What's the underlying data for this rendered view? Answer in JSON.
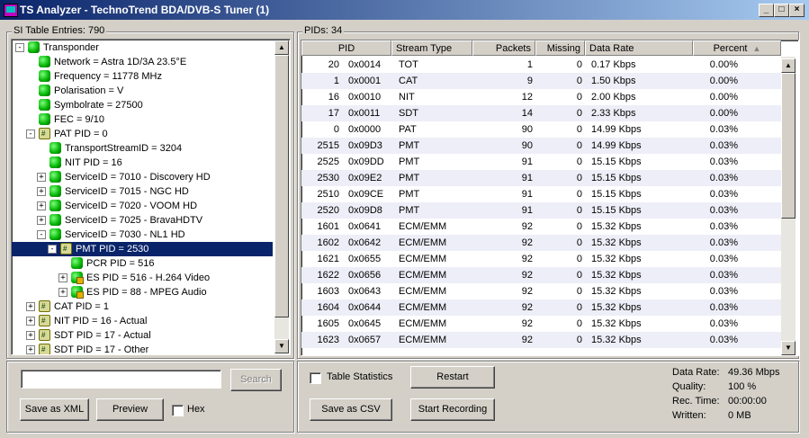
{
  "window": {
    "title": "TS Analyzer - TechnoTrend BDA/DVB-S Tuner (1)",
    "controls": [
      "_",
      "□",
      "×"
    ]
  },
  "left_panel": {
    "label": "SI Table Entries: 790",
    "tree": [
      {
        "depth": 0,
        "label": "Transponder",
        "icon": "node",
        "exp": "-"
      },
      {
        "depth": 1,
        "label": "Network = Astra 1D/3A 23.5°E",
        "icon": "node",
        "exp": ""
      },
      {
        "depth": 1,
        "label": "Frequency = 11778 MHz",
        "icon": "node",
        "exp": ""
      },
      {
        "depth": 1,
        "label": "Polarisation = V",
        "icon": "node",
        "exp": ""
      },
      {
        "depth": 1,
        "label": "Symbolrate = 27500",
        "icon": "node",
        "exp": ""
      },
      {
        "depth": 1,
        "label": "FEC = 9/10",
        "icon": "node",
        "exp": ""
      },
      {
        "depth": 1,
        "label": "PAT PID = 0",
        "icon": "folder",
        "exp": "-"
      },
      {
        "depth": 2,
        "label": "TransportStreamID = 3204",
        "icon": "node",
        "exp": ""
      },
      {
        "depth": 2,
        "label": "NIT PID = 16",
        "icon": "node",
        "exp": ""
      },
      {
        "depth": 2,
        "label": "ServiceID = 7010 - Discovery HD",
        "icon": "node",
        "exp": "+"
      },
      {
        "depth": 2,
        "label": "ServiceID = 7015 - NGC HD",
        "icon": "node",
        "exp": "+"
      },
      {
        "depth": 2,
        "label": "ServiceID = 7020 - VOOM HD",
        "icon": "node",
        "exp": "+"
      },
      {
        "depth": 2,
        "label": "ServiceID = 7025 - BravaHDTV",
        "icon": "node",
        "exp": "+"
      },
      {
        "depth": 2,
        "label": "ServiceID = 7030 - NL1 HD",
        "icon": "node",
        "exp": "-"
      },
      {
        "depth": 3,
        "label": "PMT PID = 2530",
        "icon": "folder",
        "exp": "-",
        "selected": true
      },
      {
        "depth": 4,
        "label": "PCR PID = 516",
        "icon": "node",
        "exp": ""
      },
      {
        "depth": 4,
        "label": "ES PID = 516 - H.264 Video",
        "icon": "es",
        "exp": "+"
      },
      {
        "depth": 4,
        "label": "ES PID = 88 - MPEG Audio",
        "icon": "es",
        "exp": "+"
      },
      {
        "depth": 1,
        "label": "CAT PID = 1",
        "icon": "folder",
        "exp": "+"
      },
      {
        "depth": 1,
        "label": "NIT PID = 16 - Actual",
        "icon": "folder",
        "exp": "+"
      },
      {
        "depth": 1,
        "label": "SDT PID = 17 - Actual",
        "icon": "folder",
        "exp": "+"
      },
      {
        "depth": 1,
        "label": "SDT PID = 17 - Other",
        "icon": "folder",
        "exp": "+"
      }
    ],
    "search_value": "",
    "search_button": "Search",
    "save_xml_button": "Save as XML",
    "preview_button": "Preview",
    "hex_label": "Hex"
  },
  "right_panel": {
    "label": "PIDs: 34",
    "columns": [
      "PID",
      "Stream Type",
      "Packets",
      "Missing",
      "Data Rate",
      "Percent"
    ],
    "sort_indicator": "▲",
    "rows": [
      [
        "20",
        "0x0014",
        "TOT",
        "1",
        "0",
        "0.17 Kbps",
        "0.00%"
      ],
      [
        "1",
        "0x0001",
        "CAT",
        "9",
        "0",
        "1.50 Kbps",
        "0.00%"
      ],
      [
        "16",
        "0x0010",
        "NIT",
        "12",
        "0",
        "2.00 Kbps",
        "0.00%"
      ],
      [
        "17",
        "0x0011",
        "SDT",
        "14",
        "0",
        "2.33 Kbps",
        "0.00%"
      ],
      [
        "0",
        "0x0000",
        "PAT",
        "90",
        "0",
        "14.99 Kbps",
        "0.03%"
      ],
      [
        "2515",
        "0x09D3",
        "PMT",
        "90",
        "0",
        "14.99 Kbps",
        "0.03%"
      ],
      [
        "2525",
        "0x09DD",
        "PMT",
        "91",
        "0",
        "15.15 Kbps",
        "0.03%"
      ],
      [
        "2530",
        "0x09E2",
        "PMT",
        "91",
        "0",
        "15.15 Kbps",
        "0.03%"
      ],
      [
        "2510",
        "0x09CE",
        "PMT",
        "91",
        "0",
        "15.15 Kbps",
        "0.03%"
      ],
      [
        "2520",
        "0x09D8",
        "PMT",
        "91",
        "0",
        "15.15 Kbps",
        "0.03%"
      ],
      [
        "1601",
        "0x0641",
        "ECM/EMM",
        "92",
        "0",
        "15.32 Kbps",
        "0.03%"
      ],
      [
        "1602",
        "0x0642",
        "ECM/EMM",
        "92",
        "0",
        "15.32 Kbps",
        "0.03%"
      ],
      [
        "1621",
        "0x0655",
        "ECM/EMM",
        "92",
        "0",
        "15.32 Kbps",
        "0.03%"
      ],
      [
        "1622",
        "0x0656",
        "ECM/EMM",
        "92",
        "0",
        "15.32 Kbps",
        "0.03%"
      ],
      [
        "1603",
        "0x0643",
        "ECM/EMM",
        "92",
        "0",
        "15.32 Kbps",
        "0.03%"
      ],
      [
        "1604",
        "0x0644",
        "ECM/EMM",
        "92",
        "0",
        "15.32 Kbps",
        "0.03%"
      ],
      [
        "1605",
        "0x0645",
        "ECM/EMM",
        "92",
        "0",
        "15.32 Kbps",
        "0.03%"
      ],
      [
        "1623",
        "0x0657",
        "ECM/EMM",
        "92",
        "0",
        "15.32 Kbps",
        "0.03%"
      ]
    ],
    "table_statistics_label": "Table Statistics",
    "restart_button": "Restart",
    "save_csv_button": "Save as CSV",
    "start_recording_button": "Start Recording",
    "stats": [
      {
        "label": "Data Rate:",
        "value": "49.36 Mbps"
      },
      {
        "label": "Quality:",
        "value": "100 %"
      },
      {
        "label": "Rec. Time:",
        "value": "00:00:00"
      },
      {
        "label": "Written:",
        "value": "0 MB"
      }
    ]
  }
}
